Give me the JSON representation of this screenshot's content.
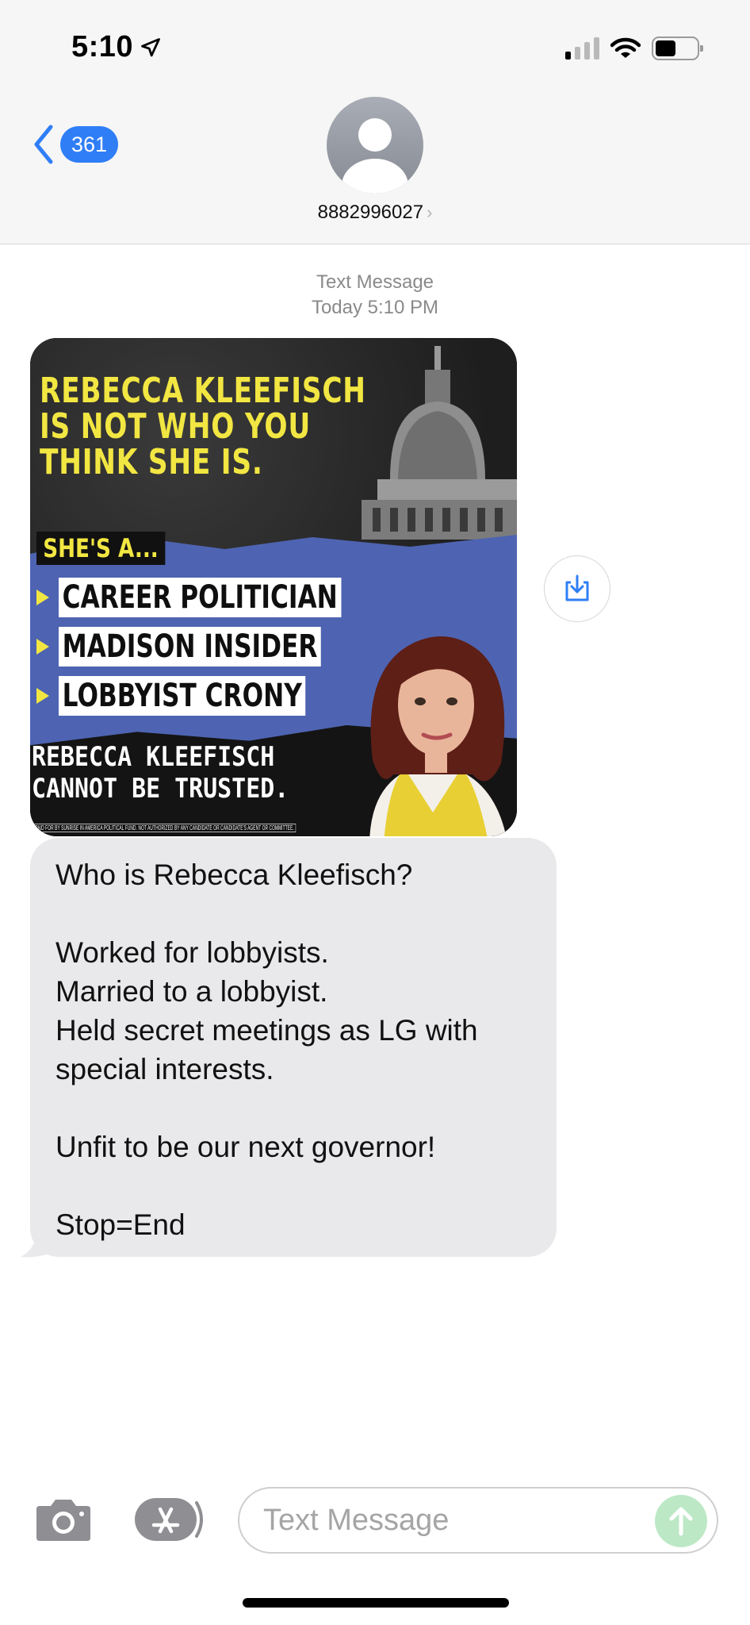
{
  "status_bar": {
    "time": "5:10"
  },
  "header": {
    "back_badge": "361",
    "contact_number": "8882996027",
    "contact_chevron": "›"
  },
  "thread": {
    "service_label": "Text Message",
    "timestamp": "Today 5:10 PM",
    "image_text": {
      "headline": "REBECCA KLEEFISCH\nIS NOT WHO YOU\nTHINK SHE IS.",
      "shes_a": "SHE'S A...",
      "bullets": [
        "CAREER POLITICIAN",
        "MADISON INSIDER",
        "LOBBYIST CRONY"
      ],
      "cannot_trust": "REBECCA KLEEFISCH\nCANNOT BE TRUSTED.",
      "disclaimer": "PAID FOR BY SUNRISE IN AMERICA POLITICAL FUND. NOT AUTHORIZED BY ANY CANDIDATE OR CANDIDATE'S AGENT OR COMMITTEE."
    },
    "message_text": "Who is Rebecca Kleefisch?\n\nWorked for lobbyists.\nMarried to a lobbyist.\nHeld secret meetings as LG with special interests.\n\nUnfit to be our next governor!\n\nStop=End"
  },
  "composer": {
    "placeholder": "Text Message"
  },
  "colors": {
    "ios_blue": "#2f7ef6",
    "bubble_gray": "#e9e9eb",
    "send_green": "#bde8c6",
    "poster_yellow": "#f2e642",
    "poster_blue": "#4e64b2"
  },
  "icons": [
    "location-arrow-icon",
    "signal-icon",
    "wifi-icon",
    "battery-icon",
    "back-chevron-icon",
    "person-icon",
    "save-image-icon",
    "camera-icon",
    "app-store-icon",
    "send-arrow-icon"
  ]
}
